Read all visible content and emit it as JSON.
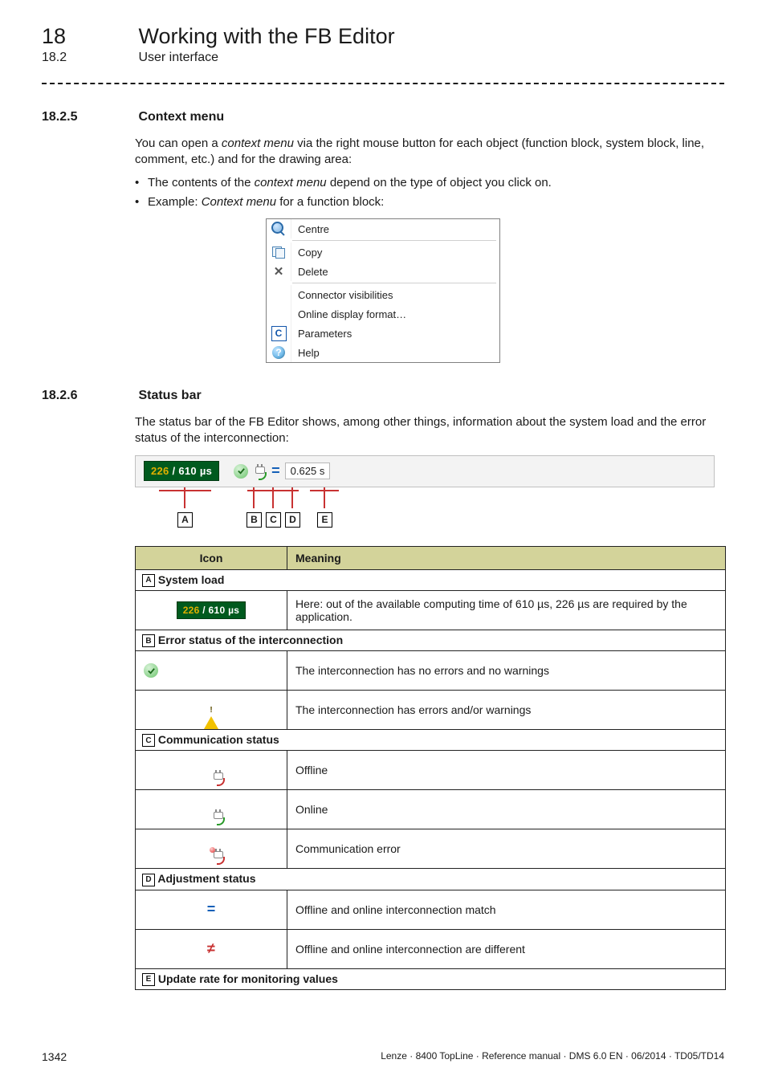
{
  "header": {
    "chapter_num": "18",
    "chapter_title": "Working with the FB Editor",
    "section_num": "18.2",
    "section_title": "User interface"
  },
  "sec1": {
    "num": "18.2.5",
    "title": "Context menu",
    "para1_a": "You can open a ",
    "para1_em": "context menu",
    "para1_b": " via the right mouse button for each object (function block, system block, line, comment, etc.) and for the drawing area:",
    "b1_a": "The contents of the ",
    "b1_em": "context menu",
    "b1_b": " depend on the type of object you click on.",
    "b2_a": "Example: ",
    "b2_em": "Context menu",
    "b2_b": " for a function block:",
    "menu": {
      "centre": "Centre",
      "copy": "Copy",
      "delete": "Delete",
      "connector": "Connector visibilities",
      "online": "Online display format…",
      "params": "Parameters",
      "help": "Help"
    }
  },
  "sec2": {
    "num": "18.2.6",
    "title": "Status bar",
    "para": "The status bar of the FB Editor shows, among other things, information about the system load and the error status of the interconnection:",
    "statusbar": {
      "load": "226 / 610 µs",
      "cycle": "0.625 s"
    },
    "letters": {
      "A": "A",
      "B": "B",
      "C": "C",
      "D": "D",
      "E": "E"
    }
  },
  "table": {
    "hdr_icon": "Icon",
    "hdr_meaning": "Meaning",
    "secA": " System load",
    "rowA_meaning": "Here: out of the available computing time of 610 µs, 226 µs are required by the application.",
    "rowA_chip": "226 / 610 µs",
    "secB": " Error status of the interconnection",
    "rowB1": "The interconnection has no errors and no warnings",
    "rowB2": "The interconnection has errors and/or warnings",
    "secC": " Communication status",
    "rowC1": "Offline",
    "rowC2": "Online",
    "rowC3": "Communication error",
    "secD": " Adjustment status",
    "rowD1": "Offline and online interconnection match",
    "rowD2": "Offline and online interconnection are different",
    "secE": " Update rate for monitoring values"
  },
  "footer": {
    "page": "1342",
    "doc": "Lenze · 8400 TopLine · Reference manual · DMS 6.0 EN · 06/2014 · TD05/TD14"
  }
}
